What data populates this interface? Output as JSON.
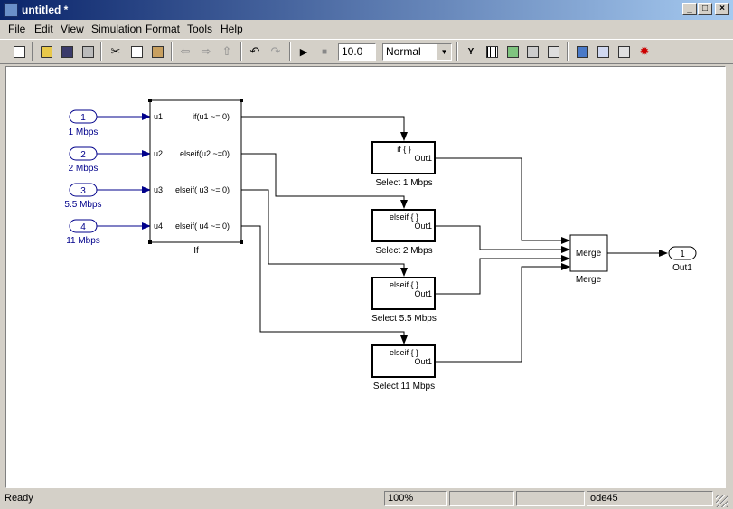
{
  "window": {
    "title": "untitled *"
  },
  "menu": [
    "File",
    "Edit",
    "View",
    "Simulation",
    "Format",
    "Tools",
    "Help"
  ],
  "toolbar": {
    "stop_time": "10.0",
    "sim_mode": "Normal",
    "tb_text_y": "Y"
  },
  "model": {
    "inports": [
      {
        "num": "1",
        "label": "1 Mbps"
      },
      {
        "num": "2",
        "label": "2 Mbps"
      },
      {
        "num": "3",
        "label": "5.5 Mbps"
      },
      {
        "num": "4",
        "label": "11 Mbps"
      }
    ],
    "if_block": {
      "name": "If",
      "in_ports": [
        "u1",
        "u2",
        "u3",
        "u4"
      ],
      "conditions": [
        "if(u1 ~= 0)",
        "elseif(u2 ~=0)",
        "elseif( u3 ~= 0)",
        "elseif( u4 ~= 0)"
      ]
    },
    "subsystems": [
      {
        "header": "if { }",
        "out": "Out1",
        "name": "Select 1 Mbps"
      },
      {
        "header": "elseif { }",
        "out": "Out1",
        "name": "Select 2 Mbps"
      },
      {
        "header": "elseif { }",
        "out": "Out1",
        "name": "Select 5.5 Mbps"
      },
      {
        "header": "elseif { }",
        "out": "Out1",
        "name": "Select 11 Mbps"
      }
    ],
    "merge": {
      "inner": "Merge",
      "name": "Merge"
    },
    "outport": {
      "num": "1",
      "label": "Out1"
    }
  },
  "status": {
    "state": "Ready",
    "zoom": "100%",
    "solver": "ode45"
  },
  "colors": {
    "signal_line": "#000000",
    "inport_line": "#00008b",
    "title_start": "#0a246a"
  }
}
